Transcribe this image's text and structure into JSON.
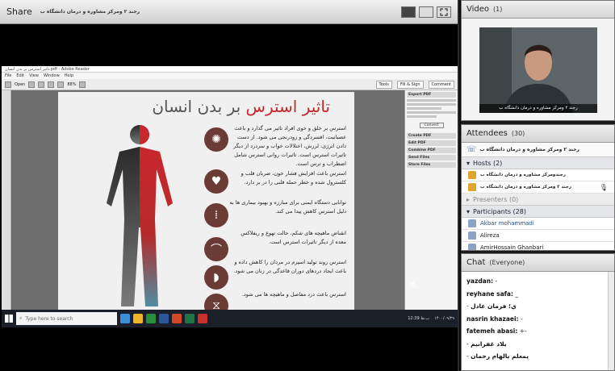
{
  "share": {
    "title": "Share",
    "presenter_banner": "رجند ۲ ومرکز مشاوره و درمان دانشگاه ب"
  },
  "reader": {
    "window_title": "تاثیر استرس بر بدن انسان.pdf - Adobe Reader",
    "menu": [
      "File",
      "Edit",
      "View",
      "Window",
      "Help"
    ],
    "toolbar_open": "Open",
    "tools": [
      "Tools",
      "Fill & Sign",
      "Comment"
    ],
    "zoom": "88%",
    "page_title_red": "تاثیر استرس",
    "page_title_gray": "بر بدن انسان",
    "paragraphs": [
      "استرس بر خلق و خوی افراد تاثیر می گذارد و باعث عصبانیت، افسردگی و زودرنجی می شود. از دست دادن انرژی، لرزش، اختلالات خواب و سردرد از دیگر تاثیرات استرس است. تاثیرات روانی استرس شامل اضطراب و ترس است.",
      "استرس باعث افزایش فشار خون، ضربان قلب و کلسترول شده و خطر حمله قلبی را در بر دارد.",
      "توانایی دستگاه ایمنی برای مبارزه و بهبود بیماری ها به دلیل استرس کاهش پیدا می کند.",
      "انقباض ماهیچه های شکم، حالت تهوع و ریفلاکس معده از دیگر تاثیرات استرس است.",
      "استرس روند تولید اسپرم در مردان را کاهش داده و باعث ایجاد دردهای دوران قاعدگی در زنان می شود.",
      "استرس باعث درد مفاصل و ماهیچه ها می شود."
    ],
    "right_panel": {
      "export": "Export PDF",
      "create": "Create PDF",
      "edit": "Edit PDF",
      "combine": "Combine PDF",
      "send": "Send Files",
      "store": "Store Files",
      "convert_btn": "Convert"
    }
  },
  "taskbar": {
    "search_placeholder": "Type here to search",
    "time": "12:39 ب.ظ",
    "date": "۱۴۰۰/۰۹/۲۹"
  },
  "video": {
    "title": "Video",
    "count": "(1)",
    "caption": "رجند ۲ ومرکز مشاوره و درمان دانشگاه ب"
  },
  "attendees": {
    "title": "Attendees",
    "count": "(30)",
    "me": "رجند ۲ ومرکز مشاوره و درمان دانشگاه ب",
    "hosts_label": "Hosts (2)",
    "hosts": [
      "رجندومرکز مشاوره و درمان دانشگاه ب",
      "رجند ۲ ومرکز مشاوره و درمان دانشگاه ب"
    ],
    "presenters_label": "Presenters (0)",
    "participants_label": "Participants (28)",
    "participants": [
      "Akbar mohammadi",
      "Alireza",
      "AmirHossain Ghanbari"
    ]
  },
  "chat": {
    "title": "Chat",
    "scope": "(Everyone)",
    "messages": [
      {
        "sender": "yazdan:",
        "text": " -"
      },
      {
        "sender": "reyhane safa:",
        "text": " _"
      },
      {
        "sender": "ي؛ فرمان عادل",
        "text": " -",
        "rtl": true
      },
      {
        "sender": "nasrin khazaei:",
        "text": " -"
      },
      {
        "sender": "fatemeh abasi:",
        "text": " +-"
      },
      {
        "sender": "يلاد غفرانيم",
        "text": " -",
        "rtl": true
      },
      {
        "sender": "يمعلم يالهام رحمان",
        "text": " -",
        "rtl": true
      }
    ]
  },
  "colors": {
    "title_red": "#c0282d",
    "host_icon": "#e0a52c",
    "participant_name": "#2a4c8a"
  }
}
